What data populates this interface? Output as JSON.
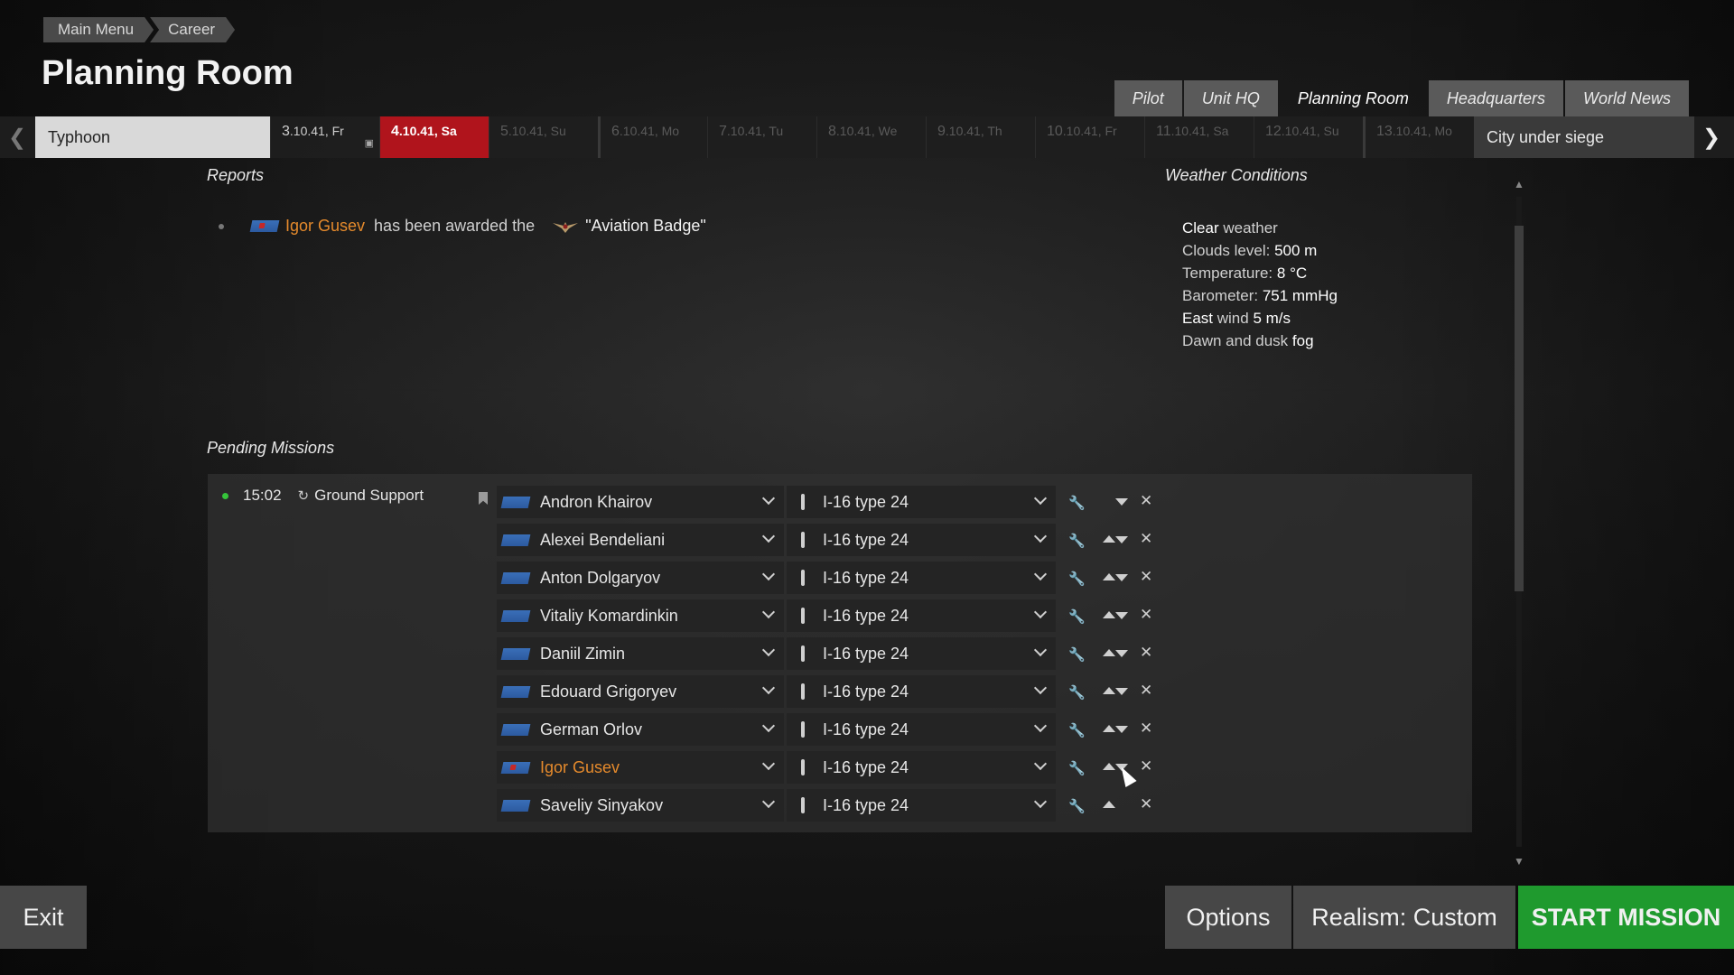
{
  "breadcrumb": [
    "Main Menu",
    "Career"
  ],
  "page_title": "Planning Room",
  "tabs": [
    {
      "label": "Pilot",
      "active": false
    },
    {
      "label": "Unit HQ",
      "active": false
    },
    {
      "label": "Planning Room",
      "active": true
    },
    {
      "label": "Headquarters",
      "active": false
    },
    {
      "label": "World News",
      "active": false
    }
  ],
  "timeline": {
    "campaign": "Typhoon",
    "days": [
      {
        "date": "3",
        "rest": ".10.41, Fr",
        "state": "past"
      },
      {
        "date": "4",
        "rest": ".10.41, Sa",
        "state": "current"
      },
      {
        "date": "5",
        "rest": ".10.41, Su",
        "state": "future"
      },
      {
        "date": "6",
        "rest": ".10.41, Mo",
        "state": "future"
      },
      {
        "date": "7",
        "rest": ".10.41, Tu",
        "state": "future"
      },
      {
        "date": "8",
        "rest": ".10.41, We",
        "state": "future"
      },
      {
        "date": "9",
        "rest": ".10.41, Th",
        "state": "future"
      },
      {
        "date": "10",
        "rest": ".10.41, Fr",
        "state": "future"
      },
      {
        "date": "11",
        "rest": ".10.41, Sa",
        "state": "future"
      },
      {
        "date": "12",
        "rest": ".10.41, Su",
        "state": "future"
      },
      {
        "date": "13",
        "rest": ".10.41, Mo",
        "state": "future"
      }
    ],
    "chapter": "City under siege"
  },
  "reports": {
    "heading": "Reports",
    "items": [
      {
        "pilot": "Igor Gusev",
        "text": "has been awarded the",
        "award": "\"Aviation Badge\""
      }
    ]
  },
  "weather": {
    "heading": "Weather Conditions",
    "lines": [
      {
        "a": "Clear",
        "b": " weather",
        "a_bright": true
      },
      {
        "a": "Clouds level: ",
        "b": "500 m",
        "a_bright": false
      },
      {
        "a": "Temperature: ",
        "b": "8 °C",
        "a_bright": false
      },
      {
        "a": "Barometer: ",
        "b": "751 mmHg",
        "a_bright": false
      },
      {
        "a": "East",
        "b": " wind ",
        "c": "5 m/s",
        "a_bright": true
      },
      {
        "a": "Dawn and dusk ",
        "b": "fog",
        "a_bright": false
      }
    ]
  },
  "pending": {
    "heading": "Pending Missions",
    "mission": {
      "time": "15:02",
      "type": "Ground Support"
    },
    "rows": [
      {
        "pilot": "Andron Khairov",
        "plane": "I-16 type 24",
        "highlight": false,
        "up": false,
        "down": true
      },
      {
        "pilot": "Alexei Bendeliani",
        "plane": "I-16 type 24",
        "highlight": false,
        "up": true,
        "down": true
      },
      {
        "pilot": "Anton Dolgaryov",
        "plane": "I-16 type 24",
        "highlight": false,
        "up": true,
        "down": true
      },
      {
        "pilot": "Vitaliy Komardinkin",
        "plane": "I-16 type 24",
        "highlight": false,
        "up": true,
        "down": true
      },
      {
        "pilot": "Daniil Zimin",
        "plane": "I-16 type 24",
        "highlight": false,
        "up": true,
        "down": true
      },
      {
        "pilot": "Edouard Grigoryev",
        "plane": "I-16 type 24",
        "highlight": false,
        "up": true,
        "down": true
      },
      {
        "pilot": "German Orlov",
        "plane": "I-16 type 24",
        "highlight": false,
        "up": true,
        "down": true
      },
      {
        "pilot": "Igor Gusev",
        "plane": "I-16 type 24",
        "highlight": true,
        "up": true,
        "down": true
      },
      {
        "pilot": "Saveliy Sinyakov",
        "plane": "I-16 type 24",
        "highlight": false,
        "up": true,
        "down": false
      }
    ]
  },
  "buttons": {
    "exit": "Exit",
    "options": "Options",
    "realism": "Realism: Custom",
    "start": "START MISSION"
  },
  "colors": {
    "accent_red": "#b0141c",
    "start_green": "#1f9a2e",
    "highlight_orange": "#e58a2c",
    "mission_dot": "#35c43a"
  }
}
